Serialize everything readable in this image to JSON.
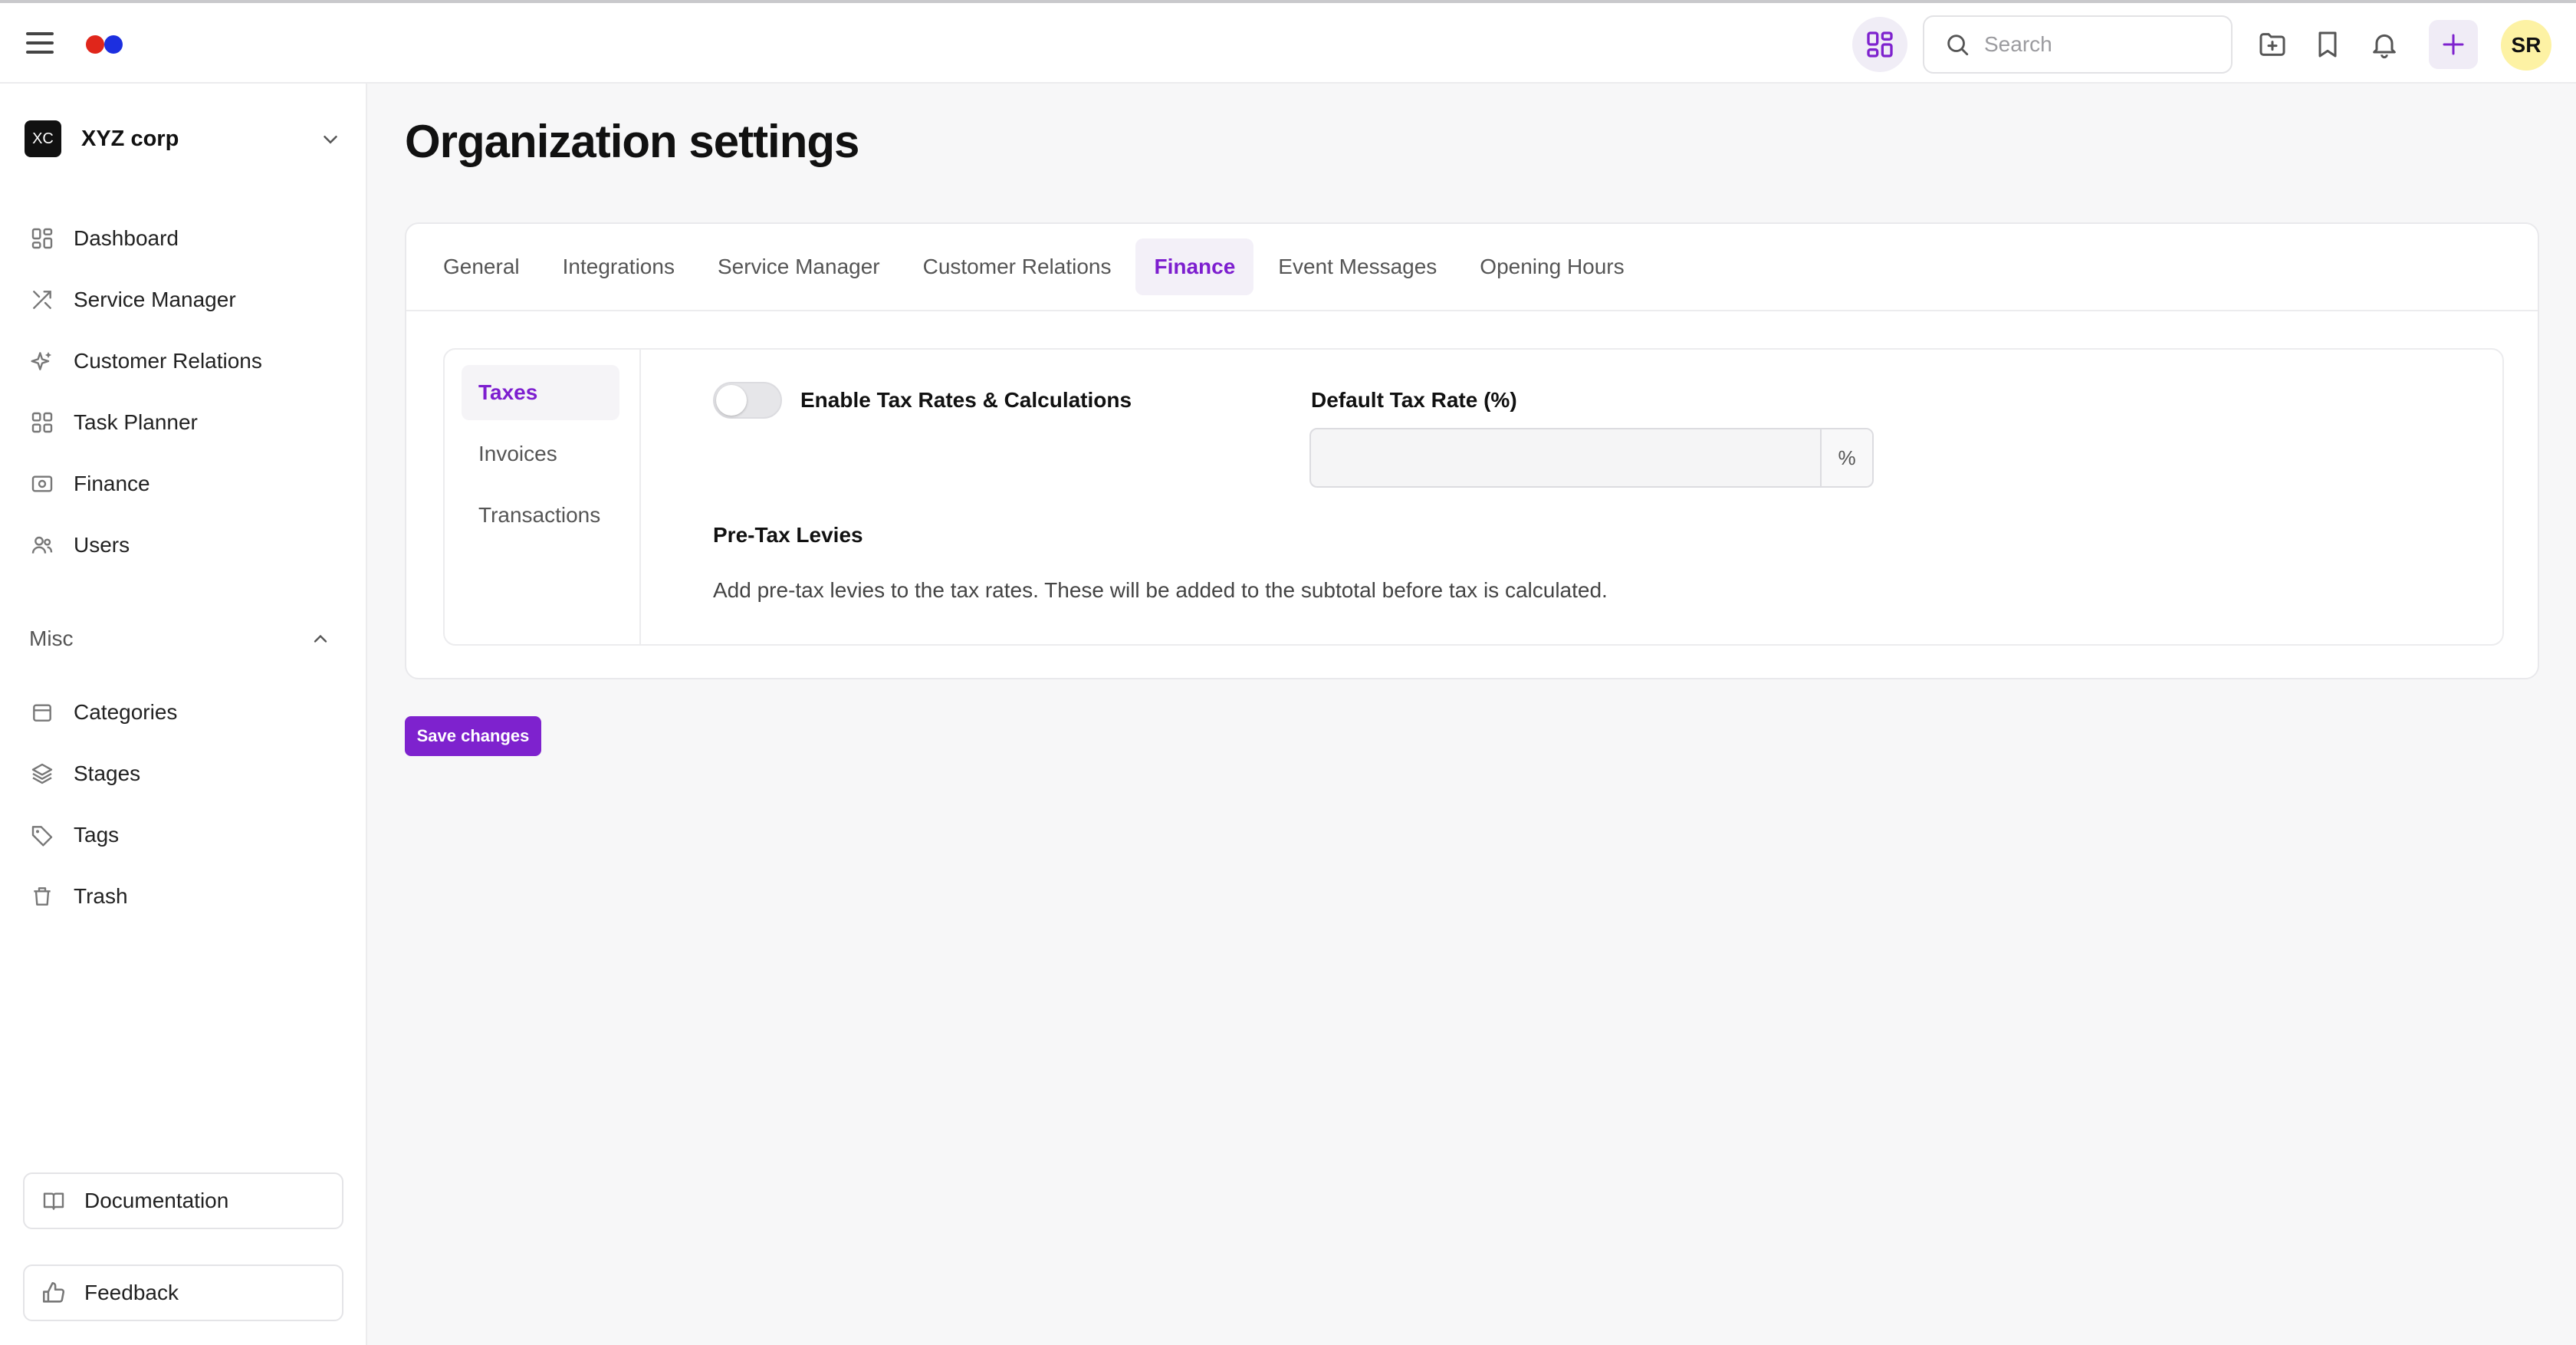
{
  "header": {
    "search_placeholder": "Search",
    "avatar_initials": "SR",
    "logo_colors": [
      "#e0261b",
      "#1c2fe0"
    ],
    "accent": "#7e22ce"
  },
  "sidebar": {
    "org_badge": "XC",
    "org_name": "XYZ corp",
    "items": [
      {
        "label": "Dashboard",
        "icon": "dashboard-icon"
      },
      {
        "label": "Service Manager",
        "icon": "tools-icon"
      },
      {
        "label": "Customer Relations",
        "icon": "sparkle-icon"
      },
      {
        "label": "Task Planner",
        "icon": "grid-icon"
      },
      {
        "label": "Finance",
        "icon": "money-icon"
      },
      {
        "label": "Users",
        "icon": "users-icon"
      }
    ],
    "misc_label": "Misc",
    "misc_items": [
      {
        "label": "Categories",
        "icon": "archive-icon"
      },
      {
        "label": "Stages",
        "icon": "layers-icon"
      },
      {
        "label": "Tags",
        "icon": "tag-icon"
      },
      {
        "label": "Trash",
        "icon": "trash-icon"
      }
    ],
    "documentation_label": "Documentation",
    "feedback_label": "Feedback"
  },
  "main": {
    "title": "Organization settings",
    "tabs": [
      {
        "label": "General",
        "active": false
      },
      {
        "label": "Integrations",
        "active": false
      },
      {
        "label": "Service Manager",
        "active": false
      },
      {
        "label": "Customer Relations",
        "active": false
      },
      {
        "label": "Finance",
        "active": true
      },
      {
        "label": "Event Messages",
        "active": false
      },
      {
        "label": "Opening Hours",
        "active": false
      }
    ],
    "subnav": [
      {
        "label": "Taxes",
        "active": true
      },
      {
        "label": "Invoices",
        "active": false
      },
      {
        "label": "Transactions",
        "active": false
      }
    ],
    "taxes": {
      "toggle_label": "Enable Tax Rates & Calculations",
      "toggle_on": false,
      "default_rate_label": "Default Tax Rate (%)",
      "default_rate_value": "",
      "rate_unit": "%",
      "levies_title": "Pre-Tax Levies",
      "levies_description": "Add pre-tax levies to the tax rates. These will be added to the subtotal before tax is calculated."
    },
    "save_label": "Save changes"
  }
}
